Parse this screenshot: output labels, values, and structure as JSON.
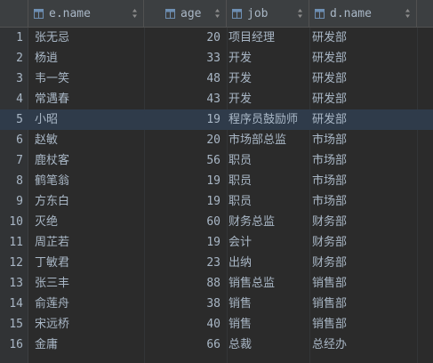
{
  "columns": [
    {
      "label": "e.name",
      "icon": "column-icon"
    },
    {
      "label": "age",
      "icon": "column-icon"
    },
    {
      "label": "job",
      "icon": "column-icon"
    },
    {
      "label": "d.name",
      "icon": "column-icon"
    }
  ],
  "rows": [
    {
      "n": "1",
      "name": "张无忌",
      "age": "20",
      "job": "项目经理",
      "dept": "研发部"
    },
    {
      "n": "2",
      "name": "杨逍",
      "age": "33",
      "job": "开发",
      "dept": "研发部"
    },
    {
      "n": "3",
      "name": "韦一笑",
      "age": "48",
      "job": "开发",
      "dept": "研发部"
    },
    {
      "n": "4",
      "name": "常遇春",
      "age": "43",
      "job": "开发",
      "dept": "研发部"
    },
    {
      "n": "5",
      "name": "小昭",
      "age": "19",
      "job": "程序员鼓励师",
      "dept": "研发部"
    },
    {
      "n": "6",
      "name": "赵敏",
      "age": "20",
      "job": "市场部总监",
      "dept": "市场部"
    },
    {
      "n": "7",
      "name": "鹿杖客",
      "age": "56",
      "job": "职员",
      "dept": "市场部"
    },
    {
      "n": "8",
      "name": "鹤笔翁",
      "age": "19",
      "job": "职员",
      "dept": "市场部"
    },
    {
      "n": "9",
      "name": "方东白",
      "age": "19",
      "job": "职员",
      "dept": "市场部"
    },
    {
      "n": "10",
      "name": "灭绝",
      "age": "60",
      "job": "财务总监",
      "dept": "财务部"
    },
    {
      "n": "11",
      "name": "周芷若",
      "age": "19",
      "job": "会计",
      "dept": "财务部"
    },
    {
      "n": "12",
      "name": "丁敏君",
      "age": "23",
      "job": "出纳",
      "dept": "财务部"
    },
    {
      "n": "13",
      "name": "张三丰",
      "age": "88",
      "job": "销售总监",
      "dept": "销售部"
    },
    {
      "n": "14",
      "name": "俞莲舟",
      "age": "38",
      "job": "销售",
      "dept": "销售部"
    },
    {
      "n": "15",
      "name": "宋远桥",
      "age": "40",
      "job": "销售",
      "dept": "销售部"
    },
    {
      "n": "16",
      "name": "金庸",
      "age": "66",
      "job": "总裁",
      "dept": "总经办"
    }
  ],
  "selected_row": "5",
  "colors": {
    "background": "#2b2b2b",
    "header": "#3c3f41",
    "text": "#a9b7c6",
    "selection": "#2f3b4a",
    "column_icon": "#6e8fb3"
  }
}
